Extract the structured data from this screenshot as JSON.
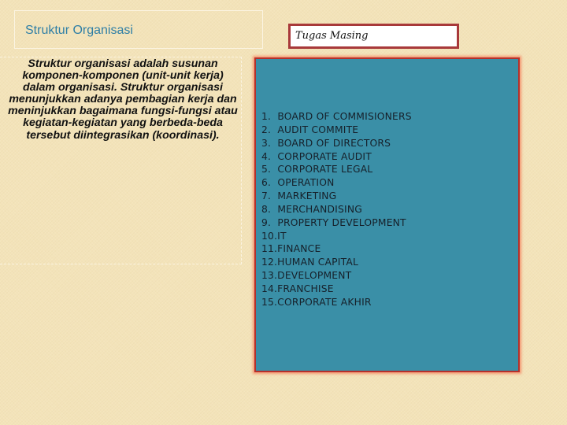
{
  "slide": {
    "title": "Struktur Organisasi",
    "description": "Struktur organisasi adalah susunan komponen-komponen (unit-unit kerja) dalam organisasi. Struktur organisasi menunjukkan adanya pembagian kerja dan meninjukkan bagaimana fungsi-fungsi atau kegiatan-kegiatan yang berbeda-beda tersebut diintegrasikan (koordinasi).",
    "panel_label": "Tugas Masing",
    "items": [
      "1.  BOARD OF COMMISIONERS",
      "2.  AUDIT COMMITE",
      "3.  BOARD OF DIRECTORS",
      "4.  CORPORATE AUDIT",
      "5.  CORPORATE LEGAL",
      "6.  OPERATION",
      "7.  MARKETING",
      "8.  MERCHANDISING",
      "9.  PROPERTY DEVELOPMENT",
      "10.IT",
      "11.FINANCE",
      "12.HUMAN CAPITAL",
      "13.DEVELOPMENT",
      "14.FRANCHISE",
      "15.CORPORATE AKHIR"
    ]
  },
  "colors": {
    "background": "#f3e3b9",
    "title": "#2f7fa6",
    "panel_fill": "#3a8fa7",
    "panel_border": "#b5302b"
  }
}
